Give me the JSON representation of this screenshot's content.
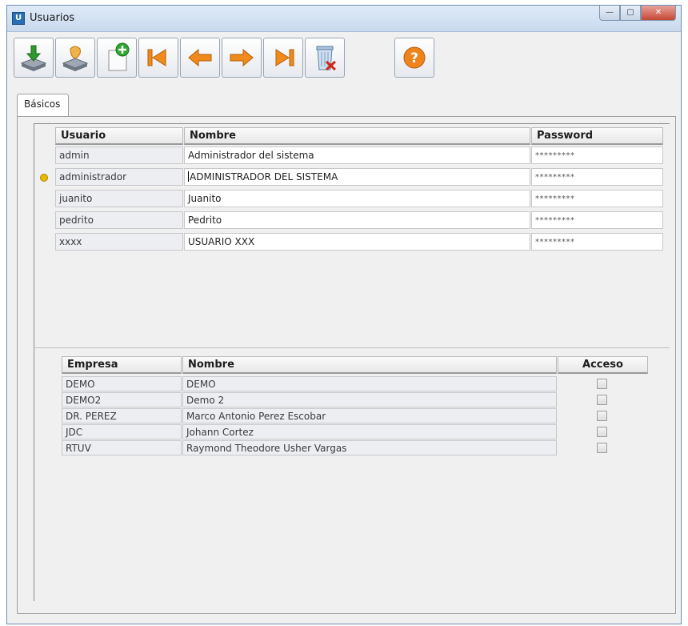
{
  "window": {
    "title": "Usuarios",
    "app_icon": "usuarios-app-icon"
  },
  "window_controls": {
    "minimize": "—",
    "maximize": "▢",
    "close": "✕"
  },
  "toolbar": {
    "buttons": [
      {
        "name": "save",
        "icon": "save-disk-icon"
      },
      {
        "name": "cancel",
        "icon": "cancel-disk-icon"
      },
      {
        "name": "new",
        "icon": "new-document-icon"
      },
      {
        "name": "first",
        "icon": "first-record-icon"
      },
      {
        "name": "previous",
        "icon": "previous-record-icon"
      },
      {
        "name": "next",
        "icon": "next-record-icon"
      },
      {
        "name": "last",
        "icon": "last-record-icon"
      },
      {
        "name": "delete",
        "icon": "delete-bin-icon"
      },
      {
        "name": "help",
        "icon": "help-icon"
      }
    ]
  },
  "tabs": [
    {
      "label": "Básicos",
      "active": true
    }
  ],
  "users_grid": {
    "columns": [
      "Usuario",
      "Nombre",
      "Password"
    ],
    "rows": [
      {
        "usuario": "admin",
        "nombre": "Administrador del sistema",
        "password": "*********"
      },
      {
        "usuario": "administrador",
        "nombre": "ADMINISTRADOR DEL SISTEMA",
        "password": "*********",
        "current": true
      },
      {
        "usuario": "juanito",
        "nombre": "Juanito",
        "password": "*********"
      },
      {
        "usuario": "pedrito",
        "nombre": "Pedrito",
        "password": "*********"
      },
      {
        "usuario": "xxxx",
        "nombre": "USUARIO XXX",
        "password": "*********"
      }
    ]
  },
  "empresas_grid": {
    "columns": [
      "Empresa",
      "Nombre",
      "Acceso"
    ],
    "rows": [
      {
        "empresa": "DEMO",
        "nombre": "DEMO",
        "acceso": false
      },
      {
        "empresa": "DEMO2",
        "nombre": "Demo 2",
        "acceso": false
      },
      {
        "empresa": "DR. PEREZ",
        "nombre": "Marco Antonio Perez Escobar",
        "acceso": false
      },
      {
        "empresa": "JDC",
        "nombre": "Johann Cortez",
        "acceso": false
      },
      {
        "empresa": "RTUV",
        "nombre": "Raymond Theodore Usher Vargas",
        "acceso": false
      }
    ]
  },
  "colors": {
    "accent": "#2a6fb4",
    "row_indicator": "#e8b800",
    "nav_arrow": "#f08a1c",
    "close_button": "#c74734"
  }
}
